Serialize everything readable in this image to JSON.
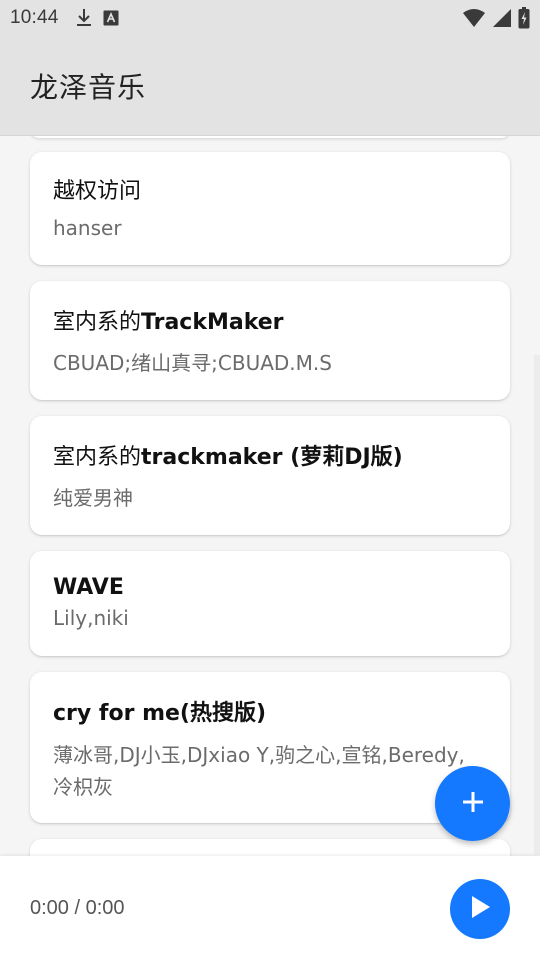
{
  "status_bar": {
    "time": "10:44",
    "left_icons": [
      "download-icon",
      "app-notification-icon"
    ],
    "right_icons": [
      "wifi-icon",
      "cell-signal-icon",
      "battery-icon"
    ]
  },
  "app_bar": {
    "title": "龙泽音乐"
  },
  "songs": [
    {
      "title_plain": "越权访问",
      "title_bold": "",
      "title_suffix": "",
      "artist": "hanser"
    },
    {
      "title_plain": "室内系的",
      "title_bold": "TrackMaker",
      "title_suffix": "",
      "artist": "CBUAD;绪山真寻;CBUAD.M.S"
    },
    {
      "title_plain": "室内系的",
      "title_bold": "trackmaker (",
      "title_suffix": "萝莉DJ版)",
      "artist": "纯爱男神"
    },
    {
      "title_plain": "",
      "title_bold": "WAVE",
      "title_suffix": "",
      "artist": "Lily,niki"
    },
    {
      "title_plain": "",
      "title_bold": "cry for me(",
      "title_suffix": "热搜版)",
      "artist_line1": "薄冰哥,DJ小玉,DJxiao Y,驹之心,宣铭,Beredy,",
      "artist_line2": "冷枳灰"
    }
  ],
  "fab": {
    "icon": "plus-icon"
  },
  "player": {
    "time_display": "0:00 / 0:00",
    "play_icon": "play-icon"
  },
  "colors": {
    "accent": "#1479ff",
    "app_bar_bg": "#e3e3e3",
    "background": "#f5f5f5"
  }
}
